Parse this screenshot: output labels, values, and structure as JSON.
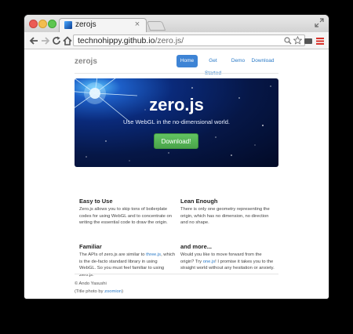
{
  "browser": {
    "tab_title": "zerojs",
    "tab_close": "×",
    "url_host": "technohippy.github.io",
    "url_path": "/zero.js/"
  },
  "site": {
    "brand": "zerojs",
    "nav": [
      {
        "label": "Home",
        "active": true
      },
      {
        "label": "Get Started",
        "active": false
      },
      {
        "label": "Demo",
        "active": false
      },
      {
        "label": "Download",
        "active": false
      }
    ]
  },
  "hero": {
    "title": "zero.js",
    "subtitle": "Use WebGL in the no-dimensional world.",
    "button": "Download!"
  },
  "features": [
    {
      "title": "Easy to Use",
      "lines": [
        "Zero.js allows you to skip tons of boilerplate",
        "codes for using WebGL and to concentrate on",
        "writing the essential code to draw the origin."
      ]
    },
    {
      "title": "Lean Enough",
      "lines": [
        "There is only one geometry representing the",
        "origin, which has no dimension, no direction",
        "and no shape."
      ]
    },
    {
      "title": "Familiar",
      "line1_pre": "The APIs of zero.js are similar to ",
      "line1_link": "three.js",
      "line1_post": ", which",
      "lines": [
        "is the de-facto standard library in using",
        "WebGL. So you must feel familiar to using",
        "zero.js."
      ]
    },
    {
      "title": "and more...",
      "line0": "Would you like to move forward from the",
      "line1_pre": "origin? Try ",
      "line1_link": "one.js",
      "line1_post": "! I promise it takes you to the",
      "line2": "straight world without any hesitation or anxiety."
    }
  ],
  "footer": {
    "copyright": "© Ando Yasushi",
    "credit_pre": "(Title photo by ",
    "credit_link": "zoomion",
    "credit_post": ")"
  },
  "colors": {
    "accent": "#3e84d5",
    "link": "#2a7ac7",
    "download_green": "#5cb85c"
  }
}
